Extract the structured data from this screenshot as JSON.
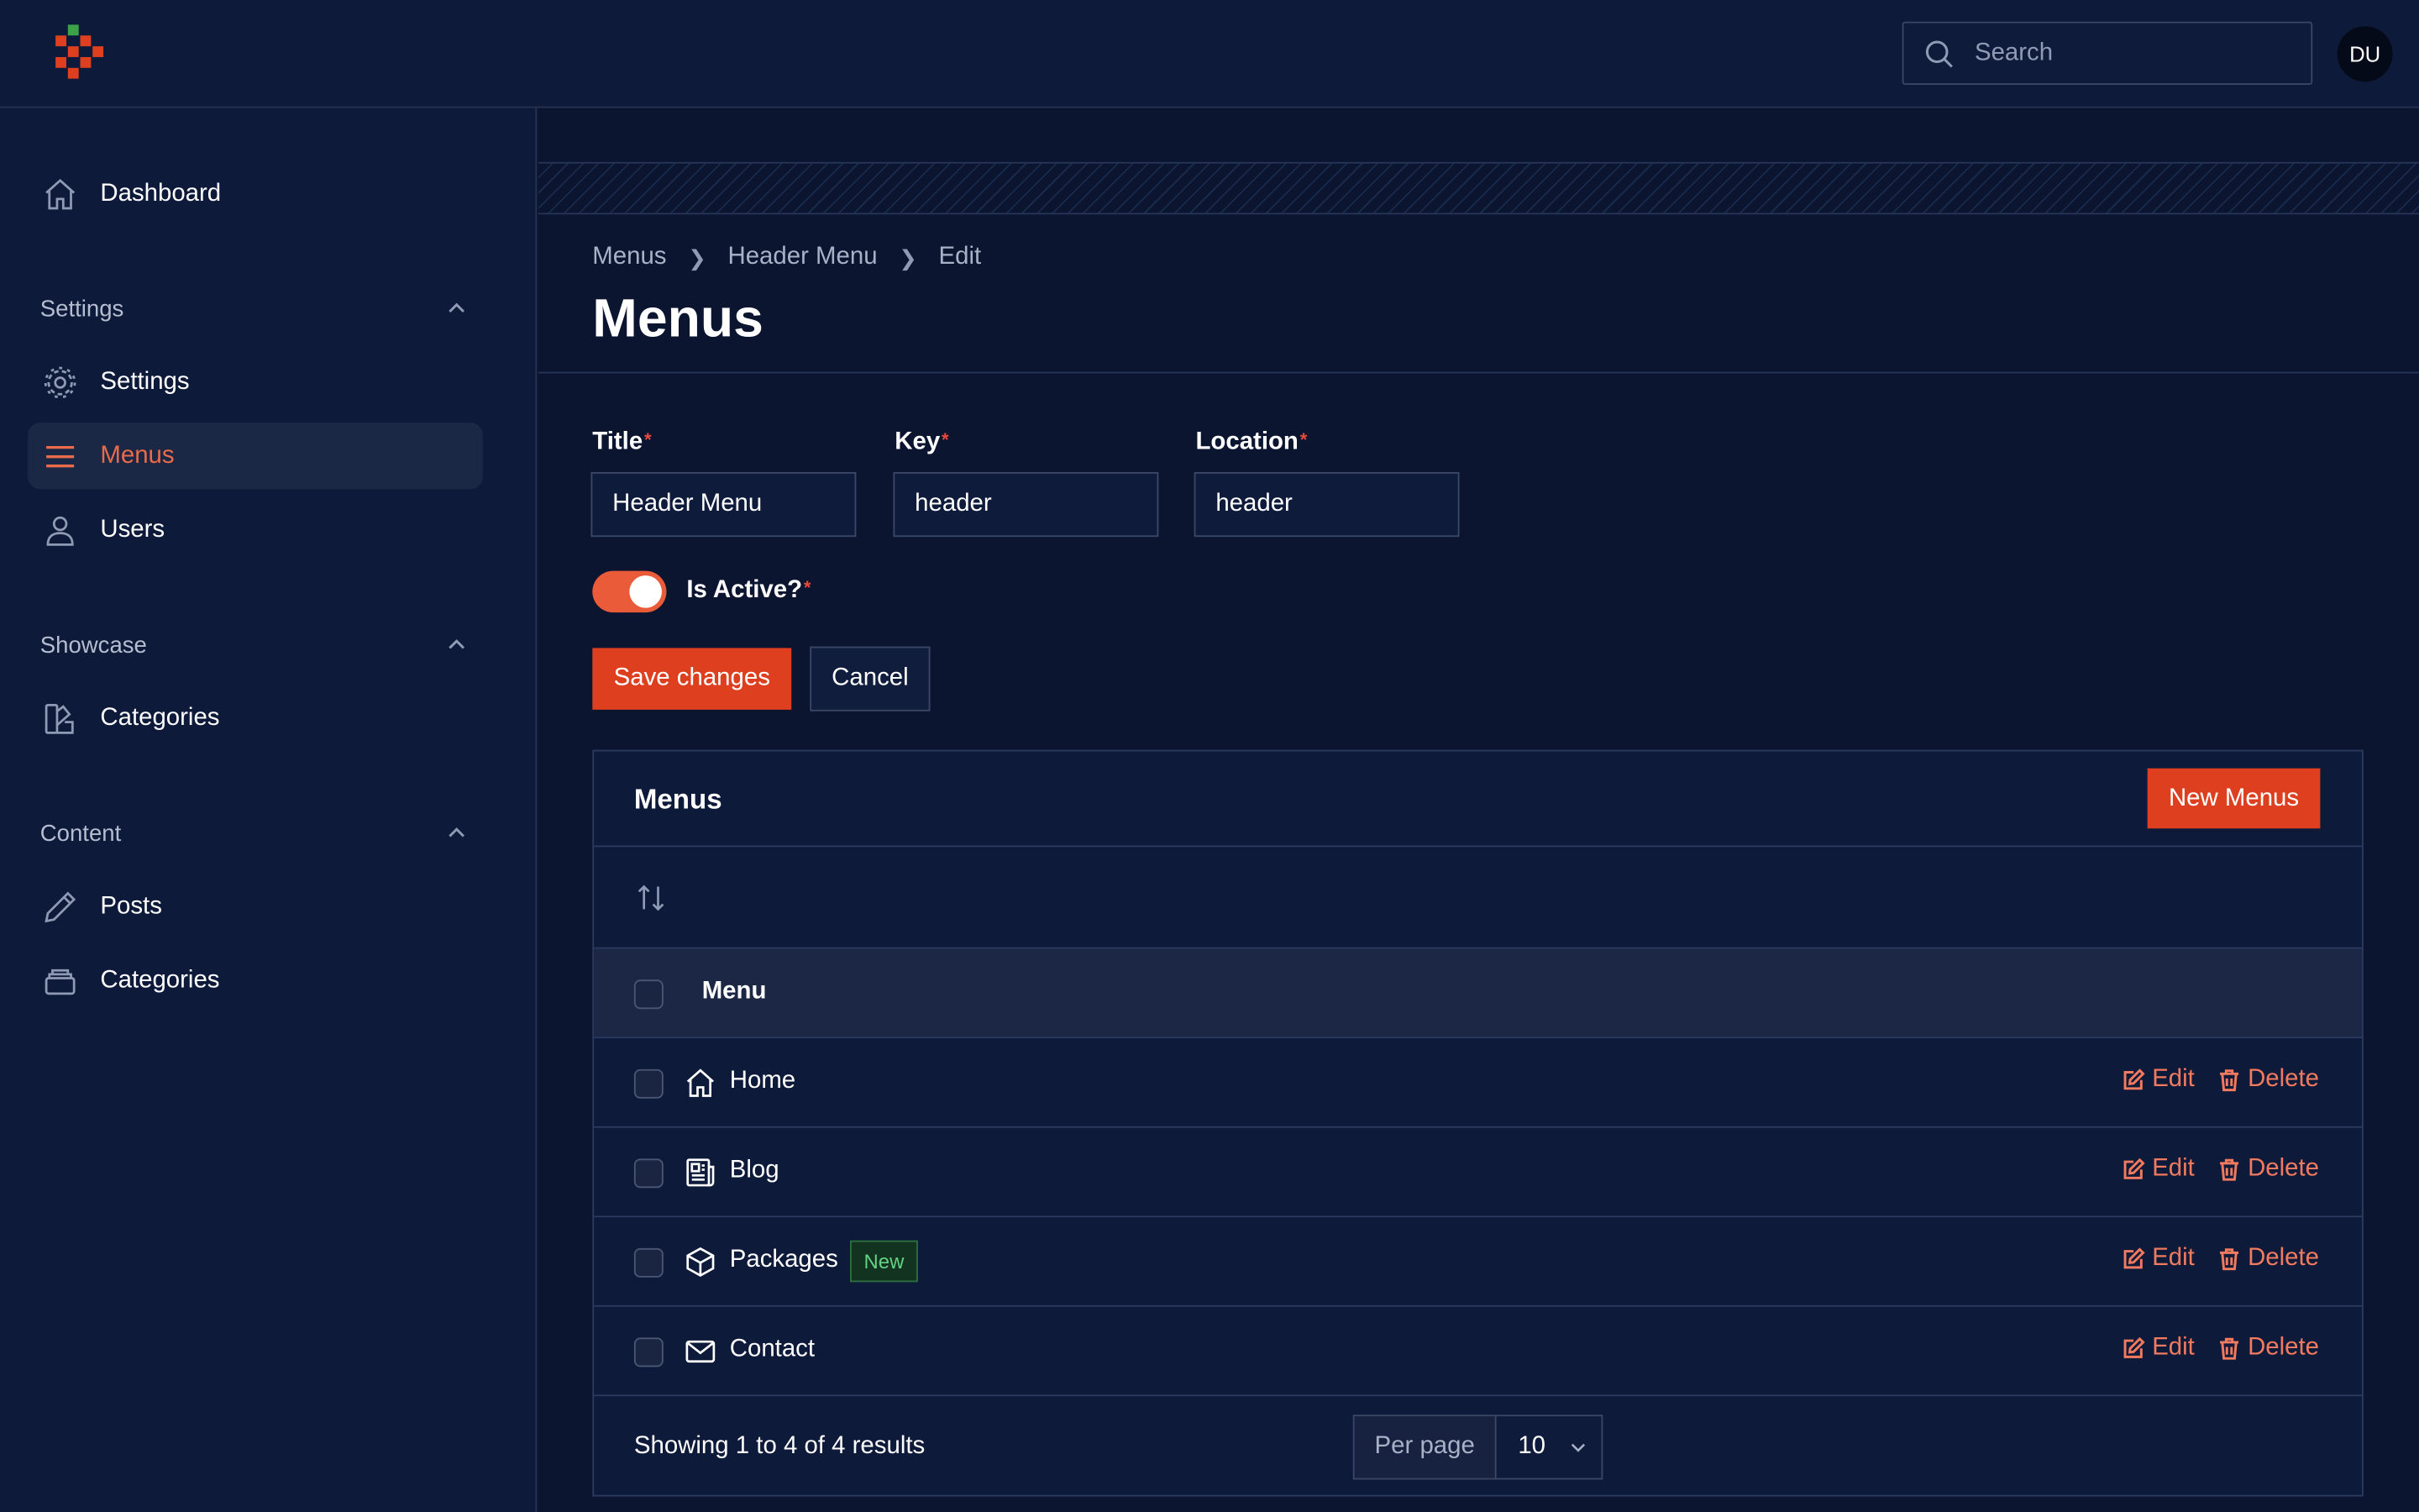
{
  "colors": {
    "accent": "#dd3f1f",
    "accent_text": "#ea6a4a",
    "background": "#0c1733",
    "badge_green": "#63d283",
    "required": "#ea4a3a"
  },
  "header": {
    "search_placeholder": "Search",
    "avatar_initials": "DU"
  },
  "sidebar": {
    "dashboard": {
      "label": "Dashboard",
      "icon": "home-icon"
    },
    "groups": [
      {
        "label": "Settings",
        "items": [
          {
            "label": "Settings",
            "icon": "gear-icon"
          },
          {
            "label": "Menus",
            "icon": "menu-lines-icon",
            "active": true
          },
          {
            "label": "Users",
            "icon": "user-icon"
          }
        ]
      },
      {
        "label": "Showcase",
        "items": [
          {
            "label": "Categories",
            "icon": "swatch-icon"
          }
        ]
      },
      {
        "label": "Content",
        "items": [
          {
            "label": "Posts",
            "icon": "pencil-icon"
          },
          {
            "label": "Categories",
            "icon": "stack-icon"
          }
        ]
      }
    ]
  },
  "breadcrumb": [
    "Menus",
    "Header Menu",
    "Edit"
  ],
  "page_title": "Menus",
  "form": {
    "title": {
      "label": "Title",
      "value": "Header Menu"
    },
    "key": {
      "label": "Key",
      "value": "header"
    },
    "location": {
      "label": "Location",
      "value": "header"
    },
    "is_active": {
      "label": "Is Active?",
      "value": true
    },
    "required_mark": "*",
    "save_label": "Save changes",
    "cancel_label": "Cancel"
  },
  "table": {
    "title": "Menus",
    "new_button": "New Menus",
    "column_header": "Menu",
    "rows": [
      {
        "label": "Home",
        "icon": "home-icon",
        "badge": ""
      },
      {
        "label": "Blog",
        "icon": "newspaper-icon",
        "badge": ""
      },
      {
        "label": "Packages",
        "icon": "cube-icon",
        "badge": "New"
      },
      {
        "label": "Contact",
        "icon": "envelope-icon",
        "badge": ""
      }
    ],
    "edit_label": "Edit",
    "delete_label": "Delete",
    "results_text": "Showing 1 to 4 of 4 results",
    "per_page_label": "Per page",
    "per_page_value": "10"
  }
}
